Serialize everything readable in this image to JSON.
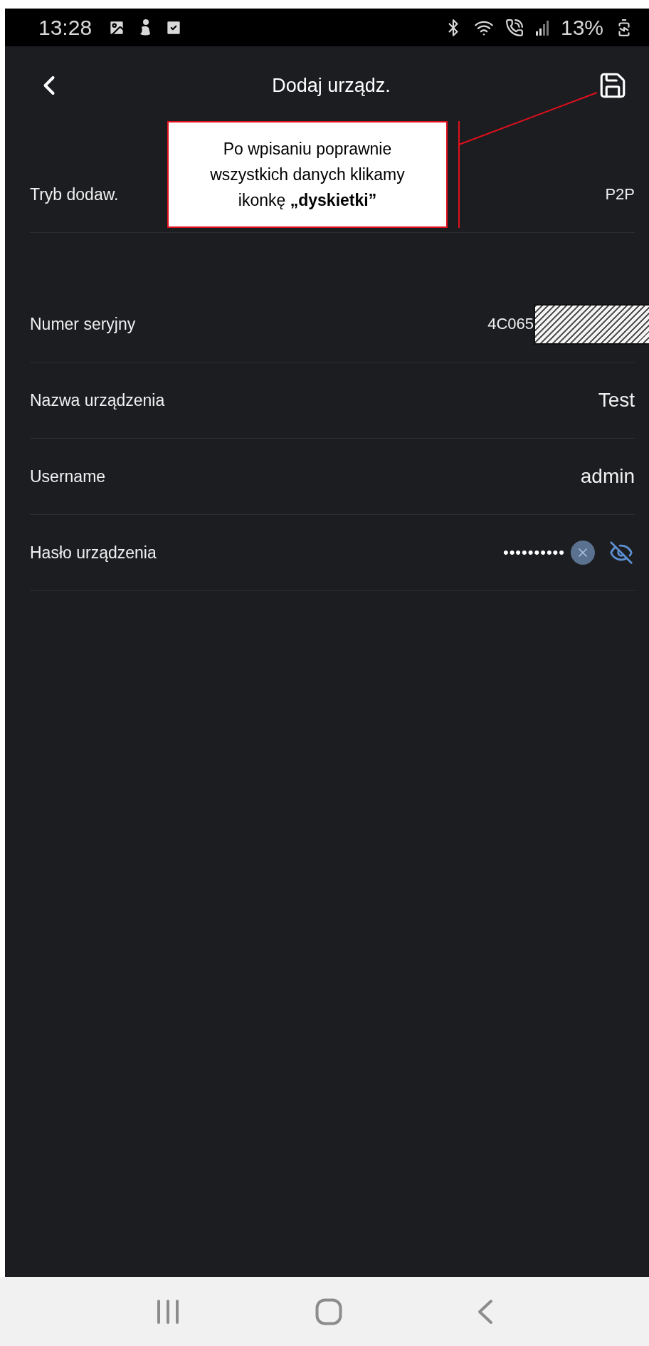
{
  "status_bar": {
    "time": "13:28",
    "battery": "13%"
  },
  "header": {
    "title": "Dodaj urządz."
  },
  "callout": {
    "text": "Po wpisaniu poprawnie wszystkich danych klikamy ikonkę **„dyskietki”**"
  },
  "groups": [
    [
      {
        "kind": "text",
        "label": "Tryb dodaw.",
        "value": "P2P"
      }
    ],
    [
      {
        "kind": "serial",
        "label": "Numer seryjny",
        "value": "4C065"
      },
      {
        "kind": "text",
        "label": "Nazwa urządzenia",
        "value": "Test"
      },
      {
        "kind": "text",
        "label": "Username",
        "value": "admin"
      },
      {
        "kind": "password",
        "label": "Hasło urządzenia",
        "value": "••••••••••",
        "visible": false
      }
    ]
  ]
}
